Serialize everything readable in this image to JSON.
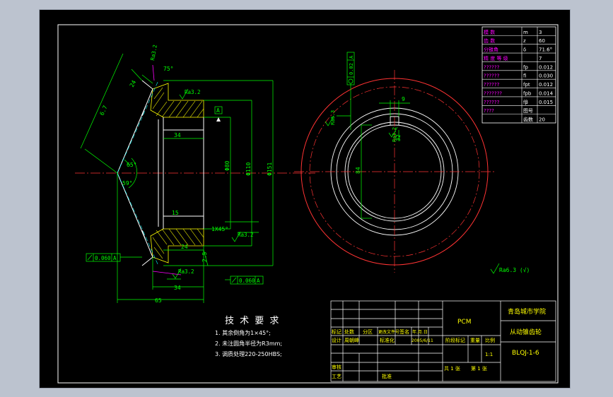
{
  "colors": {
    "background": "#000000",
    "border": "#ffffff",
    "outline": "#ffffff",
    "dimension": "#00ff00",
    "centerline": "#ff3333",
    "hatch": "#ffff00",
    "yellow_text": "#ffff00",
    "magenta": "#ff00ff",
    "cyan": "#00ffff",
    "page_bg": "#bcc3cf"
  },
  "dims_left": {
    "d24_top": "24",
    "d6_7": "6.7",
    "d34_mid": "34",
    "d24_bot": "24",
    "d34_bot": "34",
    "d65": "65",
    "phi80": "Φ80",
    "phi110": "Φ110",
    "phi151": "Φ151",
    "chamfer": "1X45°",
    "angle1": "65°",
    "angle2": "59°",
    "angle3": "75°",
    "dim15": "15",
    "small_vert": "2.5",
    "datum": "A"
  },
  "roughness": {
    "r1": "Ra3.2",
    "r2": "Ra3.2",
    "r3": "Ra3.2",
    "r4": "Ra6.3",
    "r5": "Ra3.2",
    "r6": "Ra3.2"
  },
  "tolerance_frames": {
    "left_value": "0.060",
    "left_datum": "A",
    "bottom_value": "0.060",
    "bottom_datum": "A",
    "right_value": "0.02",
    "right_datum": "A"
  },
  "dims_right": {
    "d9": "9",
    "d84": "84",
    "d32": "32"
  },
  "other_roughness": "Ra6.3 (√)",
  "params_table": [
    [
      "模  数",
      "m",
      "3"
    ],
    [
      "齿  数",
      "z",
      "60"
    ],
    [
      "分锥角",
      "δ",
      "71.6°"
    ],
    [
      "精 度 等 级",
      "",
      "7"
    ],
    [
      "??????",
      "fp",
      "0.012"
    ],
    [
      "??????",
      "fi",
      "0.030"
    ],
    [
      "??????",
      "fpt",
      "0.012"
    ],
    [
      "???????",
      "fpb",
      "0.014"
    ],
    [
      "??????",
      "fβ",
      "0.015"
    ],
    [
      "????",
      "图号",
      ""
    ],
    [
      "",
      "齿数",
      "20"
    ]
  ],
  "tech_req": {
    "title": "技 术 要 求",
    "line1": "1. 其余倒角为1×45°;",
    "line2": "2. 未注圆角半径为R3mm;",
    "line3": "3. 调质处理220-250HBS;"
  },
  "title_block": {
    "material": "PCM",
    "school": "青岛城市学院",
    "part_name": "从动锥齿轮",
    "drawing_no": "BLQJ-1-6",
    "r_mark": "标记",
    "r_count": "处数",
    "r_zone": "分区",
    "r_doc": "更改文件号",
    "r_sign": "签名",
    "r_date": "年.月.日",
    "designer_label": "设计",
    "designer": "周朝峰",
    "std_label": "标准化",
    "date": "2005/6/11",
    "stage_label": "阶段标记",
    "weight_label": "重量",
    "scale_label": "比例",
    "scale": "1:1",
    "review_label": "审核",
    "process_label": "工艺",
    "approve_label": "批准",
    "sheets": "共  1  张",
    "sheet": "第  1  张"
  }
}
